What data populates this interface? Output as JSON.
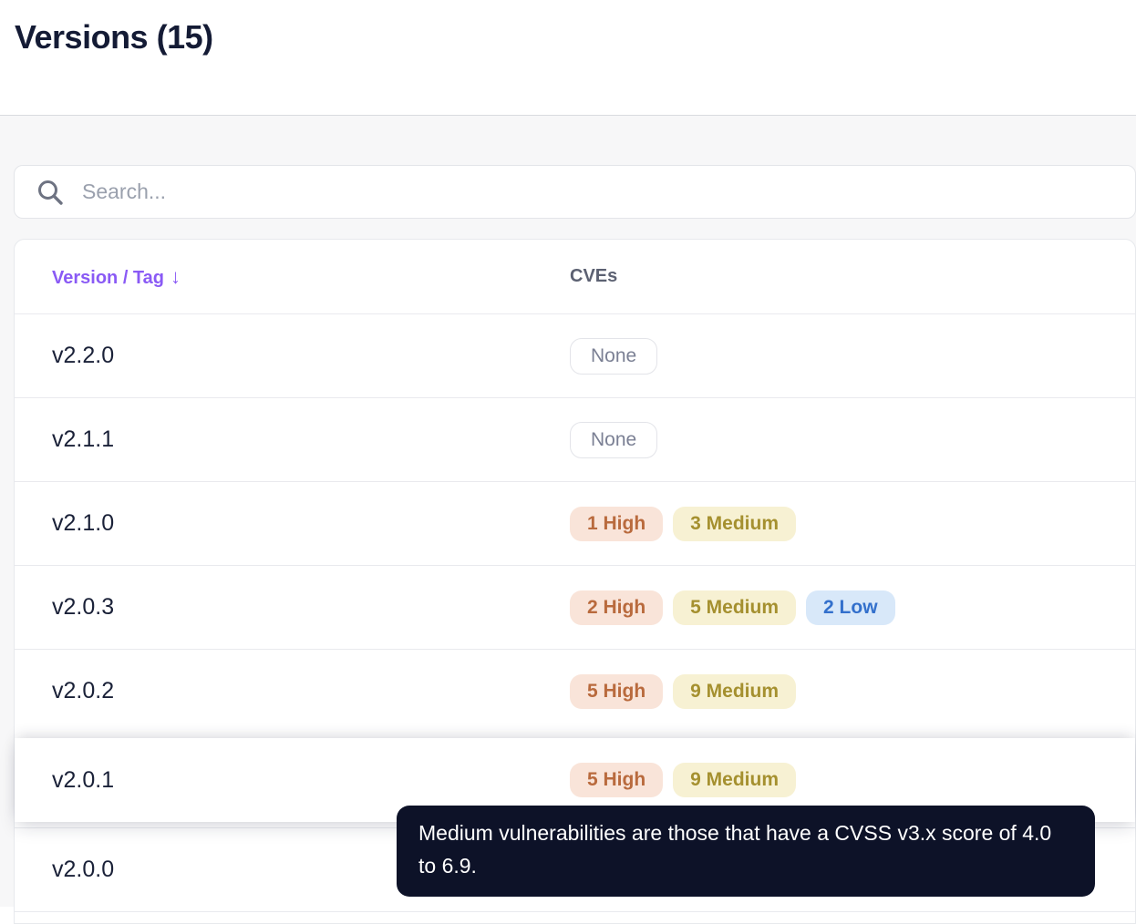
{
  "page": {
    "title": "Versions (15)"
  },
  "search": {
    "placeholder": "Search...",
    "value": ""
  },
  "table": {
    "columns": {
      "version": "Version / Tag",
      "sort_indicator": "↓",
      "cves": "CVEs"
    },
    "rows": [
      {
        "version": "v2.2.0",
        "highlighted": false,
        "badges": [
          {
            "label": "None",
            "type": "none"
          }
        ]
      },
      {
        "version": "v2.1.1",
        "highlighted": false,
        "badges": [
          {
            "label": "None",
            "type": "none"
          }
        ]
      },
      {
        "version": "v2.1.0",
        "highlighted": false,
        "badges": [
          {
            "label": "1 High",
            "type": "high"
          },
          {
            "label": "3 Medium",
            "type": "medium"
          }
        ]
      },
      {
        "version": "v2.0.3",
        "highlighted": false,
        "badges": [
          {
            "label": "2 High",
            "type": "high"
          },
          {
            "label": "5 Medium",
            "type": "medium"
          },
          {
            "label": "2 Low",
            "type": "low"
          }
        ]
      },
      {
        "version": "v2.0.2",
        "highlighted": false,
        "badges": [
          {
            "label": "5 High",
            "type": "high"
          },
          {
            "label": "9 Medium",
            "type": "medium"
          }
        ]
      },
      {
        "version": "v2.0.1",
        "highlighted": true,
        "badges": [
          {
            "label": "5 High",
            "type": "high"
          },
          {
            "label": "9 Medium",
            "type": "medium"
          }
        ]
      },
      {
        "version": "v2.0.0",
        "highlighted": false,
        "badges": []
      }
    ]
  },
  "tooltip": {
    "text": "Medium vulnerabilities are those that have a CVSS v3.x score of 4.0 to 6.9."
  },
  "colors": {
    "accent_purple": "#8a5af5",
    "title_text": "#141b35",
    "header_cves_text": "#5c6172",
    "section_bg": "#f7f7f8",
    "high_bg": "#f9e4d9",
    "high_text": "#b96a3d",
    "medium_bg": "#f7f1d3",
    "medium_text": "#a5902f",
    "low_bg": "#d8e8f9",
    "low_text": "#3370cc",
    "none_border": "#e3e4e9",
    "none_text": "#7b8094",
    "tooltip_bg": "#0d1228"
  }
}
